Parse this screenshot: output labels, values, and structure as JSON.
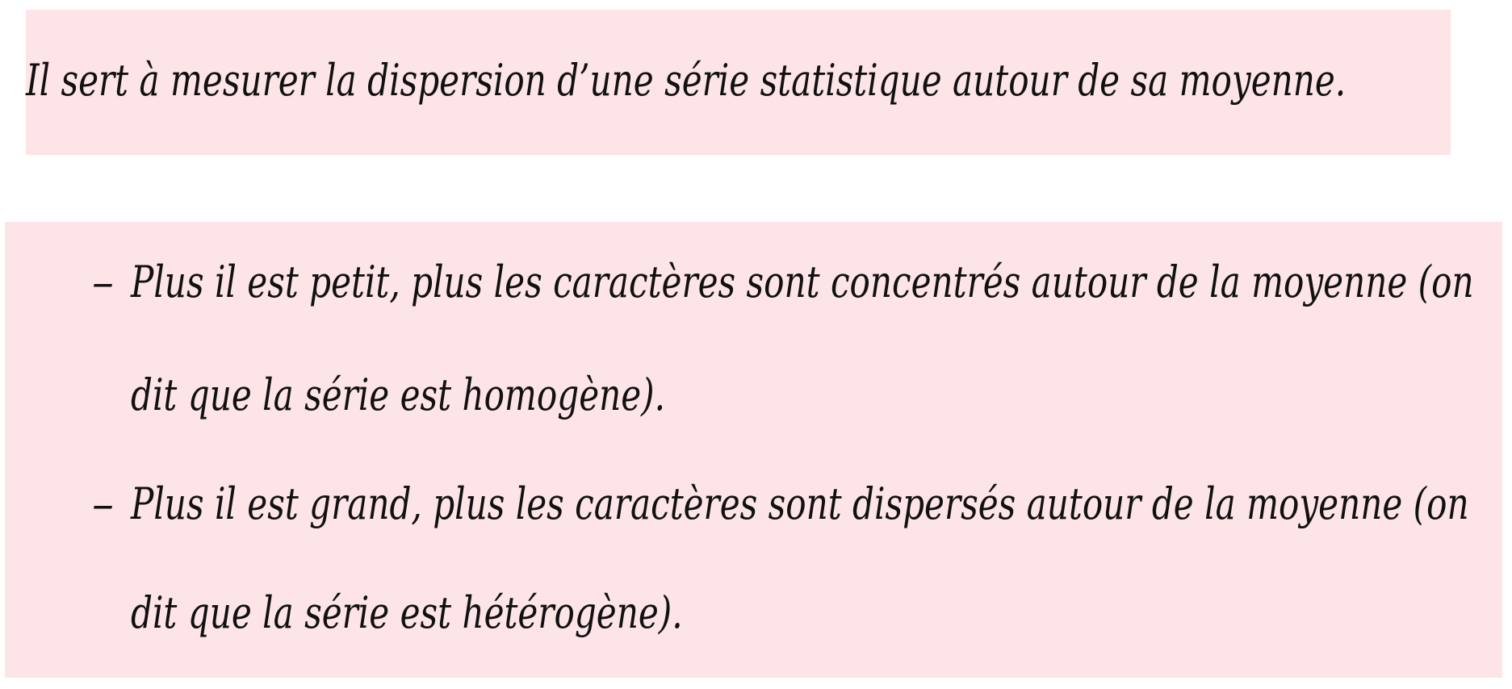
{
  "colors": {
    "box_background": "#fde4e7",
    "text": "#111111"
  },
  "definition": {
    "text": "Il sert à mesurer la dispersion d’une série statistique autour de sa moyenne."
  },
  "properties": {
    "bullet": "–",
    "items": [
      {
        "line1": "Plus il est petit, plus les caractères sont concentrés autour de la moyenne (on",
        "line2": "dit que la série est homogène)."
      },
      {
        "line1": "Plus il est grand, plus les caractères sont dispersés autour de la moyenne (on",
        "line2": "dit que la série est hétérogène)."
      }
    ]
  }
}
